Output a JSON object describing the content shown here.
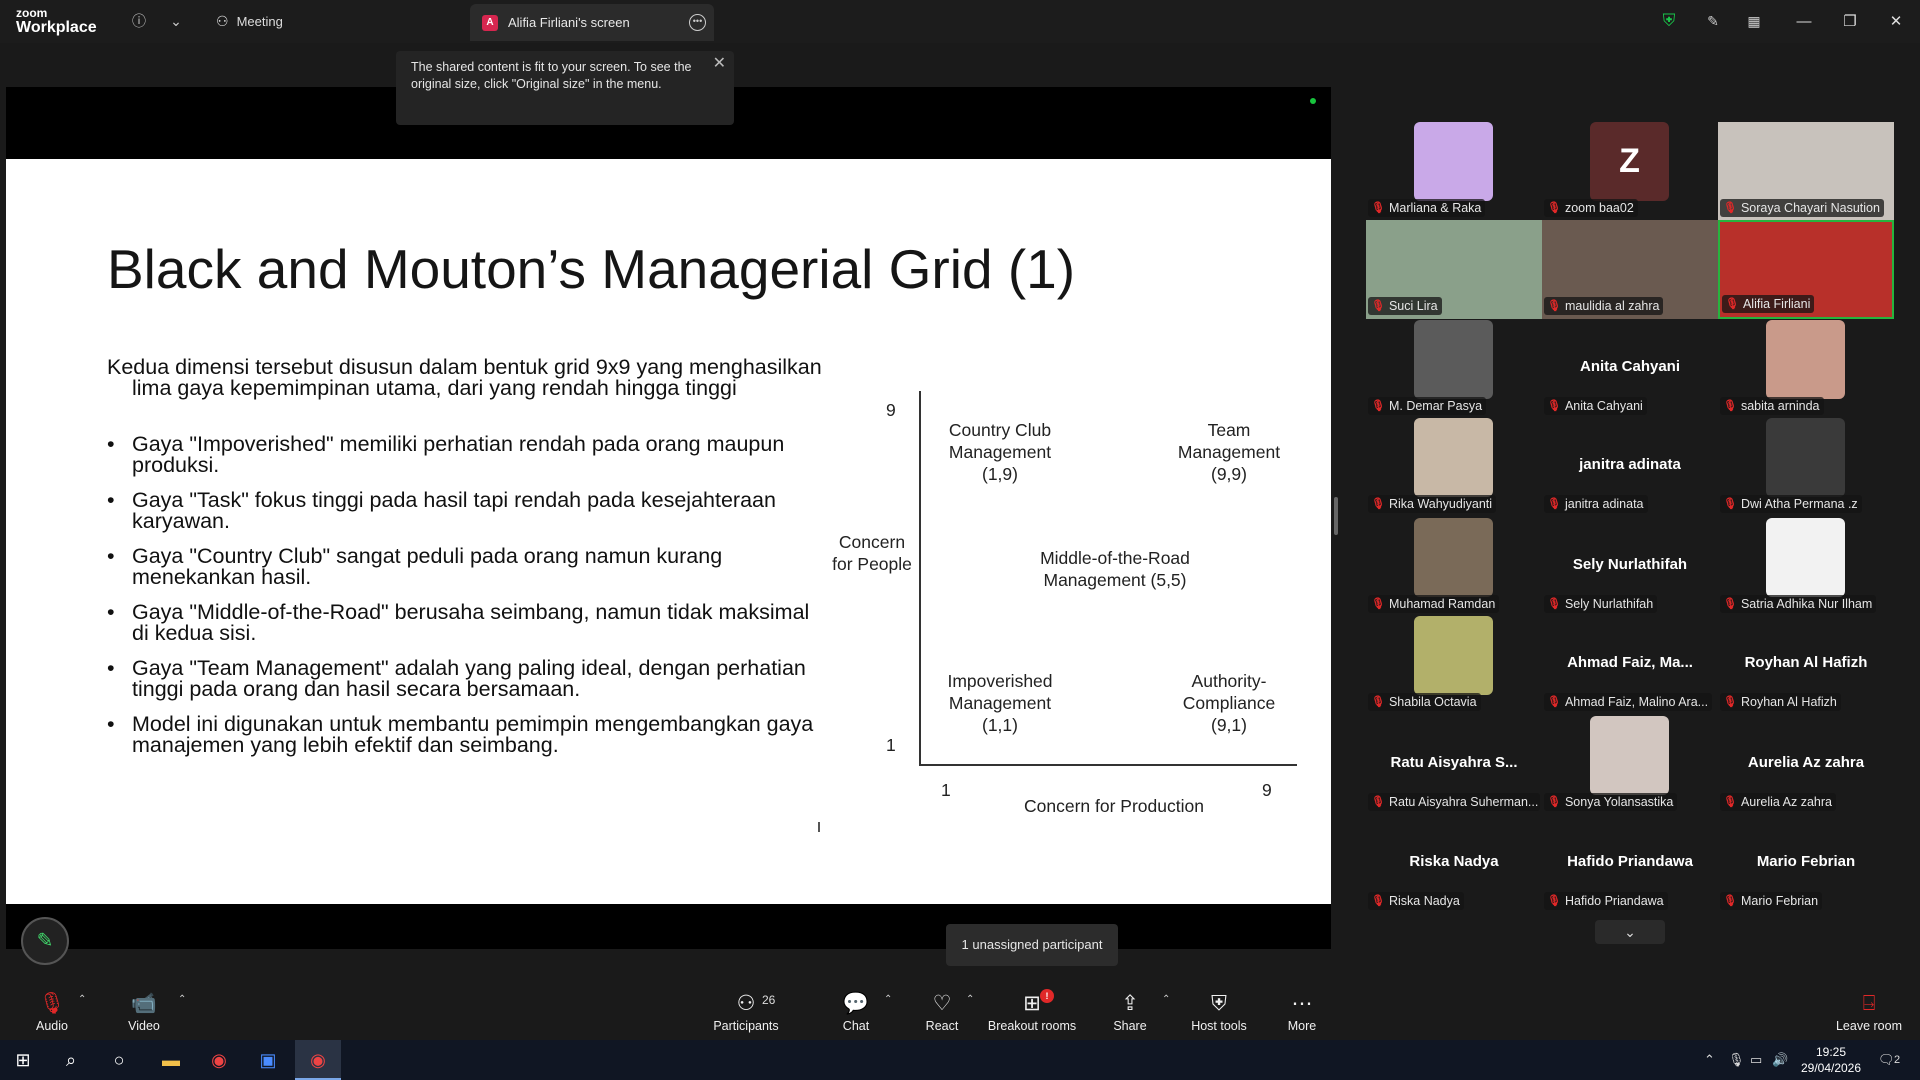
{
  "app": {
    "brand_small": "zoom",
    "brand_big": "Workplace"
  },
  "titlebar": {
    "meeting_label": "Meeting",
    "share_tab": {
      "avatar_letter": "A",
      "title": "Alifia Firliani's screen"
    }
  },
  "tooltip": {
    "text": "The shared content is fit to your screen. To see the original size, click \"Original size\" in the menu."
  },
  "slide": {
    "title": "Black and Mouton’s Managerial Grid (1)",
    "intro": "Kedua dimensi tersebut disusun dalam bentuk grid 9x9 yang menghasilkan lima gaya kepemimpinan utama, dari yang rendah hingga tinggi",
    "bullets": [
      "Gaya \"Impoverished\" memiliki perhatian rendah pada orang maupun produksi.",
      "Gaya \"Task\" fokus tinggi pada hasil tapi rendah pada kesejahteraan karyawan.",
      "Gaya \"Country Club\" sangat peduli pada orang namun kurang menekankan hasil.",
      "Gaya \"Middle-of-the-Road\" berusaha seimbang, namun tidak maksimal di kedua sisi.",
      "Gaya \"Team Management\" adalah yang paling ideal, dengan perhatian tinggi pada orang dan hasil secara bersamaan.",
      "Model ini digunakan untuk membantu pemimpin mengembangkan gaya manajemen yang lebih efektif dan seimbang."
    ],
    "grid": {
      "y_label": "Concern for People",
      "x_label": "Concern for Production",
      "y_top": "9",
      "y_bottom": "1",
      "x_left": "1",
      "x_right": "9",
      "country_club": "Country Club Management (1,9)",
      "team": "Team Management (9,9)",
      "middle": "Middle-of-the-Road Management (5,5)",
      "impoverished": "Impoverished Management (1,1)",
      "authority": "Authority-Compliance (9,1)"
    }
  },
  "participants": [
    {
      "name": "Marliana & Raka",
      "type": "image",
      "color": "#c9a9e8"
    },
    {
      "name": "zoom baa02",
      "type": "avatar",
      "letter": "Z",
      "color": "#5a2a2a"
    },
    {
      "name": "Soraya Chayari Nasution",
      "type": "video",
      "color": "#c8c2bc"
    },
    {
      "name": "Suci Lira",
      "type": "video",
      "color": "#8aa08a"
    },
    {
      "name": "maulidia al zahra",
      "type": "video",
      "color": "#6a5a50"
    },
    {
      "name": "Alifia Firliani",
      "type": "video",
      "color": "#b8302a",
      "active": true
    },
    {
      "name": "M. Demar Pasya",
      "type": "image",
      "color": "#5b5b5b"
    },
    {
      "name": "Anita Cahyani",
      "type": "name",
      "display": "Anita Cahyani"
    },
    {
      "name": "sabita arninda",
      "type": "image",
      "color": "#c99a8a"
    },
    {
      "name": "Rika Wahyudiyanti",
      "type": "image",
      "color": "#c8b8a6"
    },
    {
      "name": "janitra adinata",
      "type": "name",
      "display": "janitra adinata"
    },
    {
      "name": "Dwi Atha Permana .z",
      "type": "image",
      "color": "#3a3a3a"
    },
    {
      "name": "Muhamad Ramdan",
      "type": "image",
      "color": "#7a6a58"
    },
    {
      "name": "Sely Nurlathifah",
      "type": "name",
      "display": "Sely Nurlathifah"
    },
    {
      "name": "Satria Adhika Nur Ilham",
      "type": "image",
      "color": "#f2f2f2"
    },
    {
      "name": "Shabila Octavia",
      "type": "image",
      "color": "#b2b06a"
    },
    {
      "name": "Ahmad Faiz, Malino Ara...",
      "type": "name",
      "display": "Ahmad Faiz, Ma..."
    },
    {
      "name": "Royhan Al Hafizh",
      "type": "name",
      "display": "Royhan Al Hafizh"
    },
    {
      "name": "Ratu Aisyahra Suherman...",
      "type": "name",
      "display": "Ratu Aisyahra S..."
    },
    {
      "name": "Sonya Yolansastika",
      "type": "image",
      "color": "#d2c6c0"
    },
    {
      "name": "Aurelia Az zahra",
      "type": "name",
      "display": "Aurelia Az zahra"
    },
    {
      "name": "Riska Nadya",
      "type": "name",
      "display": "Riska Nadya"
    },
    {
      "name": "Hafido Priandawa",
      "type": "name",
      "display": "Hafido Priandawa"
    },
    {
      "name": "Mario Febrian",
      "type": "name",
      "display": "Mario Febrian"
    }
  ],
  "unassigned": "1 unassigned participant",
  "toolbar": {
    "audio": "Audio",
    "video": "Video",
    "participants": "Participants",
    "participants_count": "26",
    "chat": "Chat",
    "react": "React",
    "breakout": "Breakout rooms",
    "breakout_badge": "!",
    "share": "Share",
    "host_tools": "Host tools",
    "more": "More",
    "leave": "Leave room"
  },
  "taskbar": {
    "time": "19:25",
    "date": "29/04/2026",
    "notifications": "2"
  },
  "colors": {
    "accent_green": "#18c43d",
    "mute_red": "#e02828",
    "bg": "#1a1a1a"
  }
}
